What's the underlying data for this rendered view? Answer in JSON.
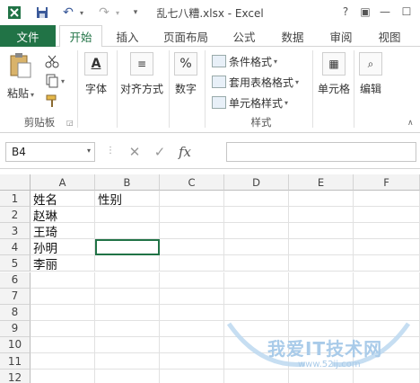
{
  "title_bar": {
    "window_title": "乱七八糟.xlsx - Excel",
    "help": "?",
    "ribbon_display": "▣",
    "minimize": "—",
    "maximize": "☐",
    "close": "✕"
  },
  "quick_access": {
    "save": "💾",
    "undo": "↶",
    "redo": "↷"
  },
  "tabs": [
    {
      "label": "文件"
    },
    {
      "label": "开始"
    },
    {
      "label": "插入"
    },
    {
      "label": "页面布局"
    },
    {
      "label": "公式"
    },
    {
      "label": "数据"
    },
    {
      "label": "审阅"
    },
    {
      "label": "视图"
    }
  ],
  "ribbon": {
    "clipboard": {
      "paste": "粘贴",
      "group": "剪贴板"
    },
    "font": {
      "label": "字体"
    },
    "alignment": {
      "label": "对齐方式"
    },
    "number": {
      "label": "数字"
    },
    "styles": {
      "conditional": "条件格式",
      "table": "套用表格格式",
      "cell_styles": "单元格样式",
      "group": "样式"
    },
    "cells": {
      "label": "单元格"
    },
    "editing": {
      "label": "编辑"
    }
  },
  "formula_bar": {
    "name_box": "B4",
    "fx": "fx",
    "content": ""
  },
  "sheet": {
    "columns": [
      "A",
      "B",
      "C",
      "D",
      "E",
      "F"
    ],
    "rows": [
      "1",
      "2",
      "3",
      "4",
      "5",
      "6",
      "7",
      "8",
      "9",
      "10",
      "11",
      "12"
    ],
    "cells": {
      "A1": "姓名",
      "B1": "性别",
      "A2": "赵琳",
      "A3": "王琦",
      "A4": "孙明",
      "A5": "李丽"
    }
  },
  "watermark": {
    "text": "我爱IT技术网",
    "url": "www.52ij.com"
  },
  "colors": {
    "accent": "#217346",
    "header_bg": "#f3f3f3"
  }
}
